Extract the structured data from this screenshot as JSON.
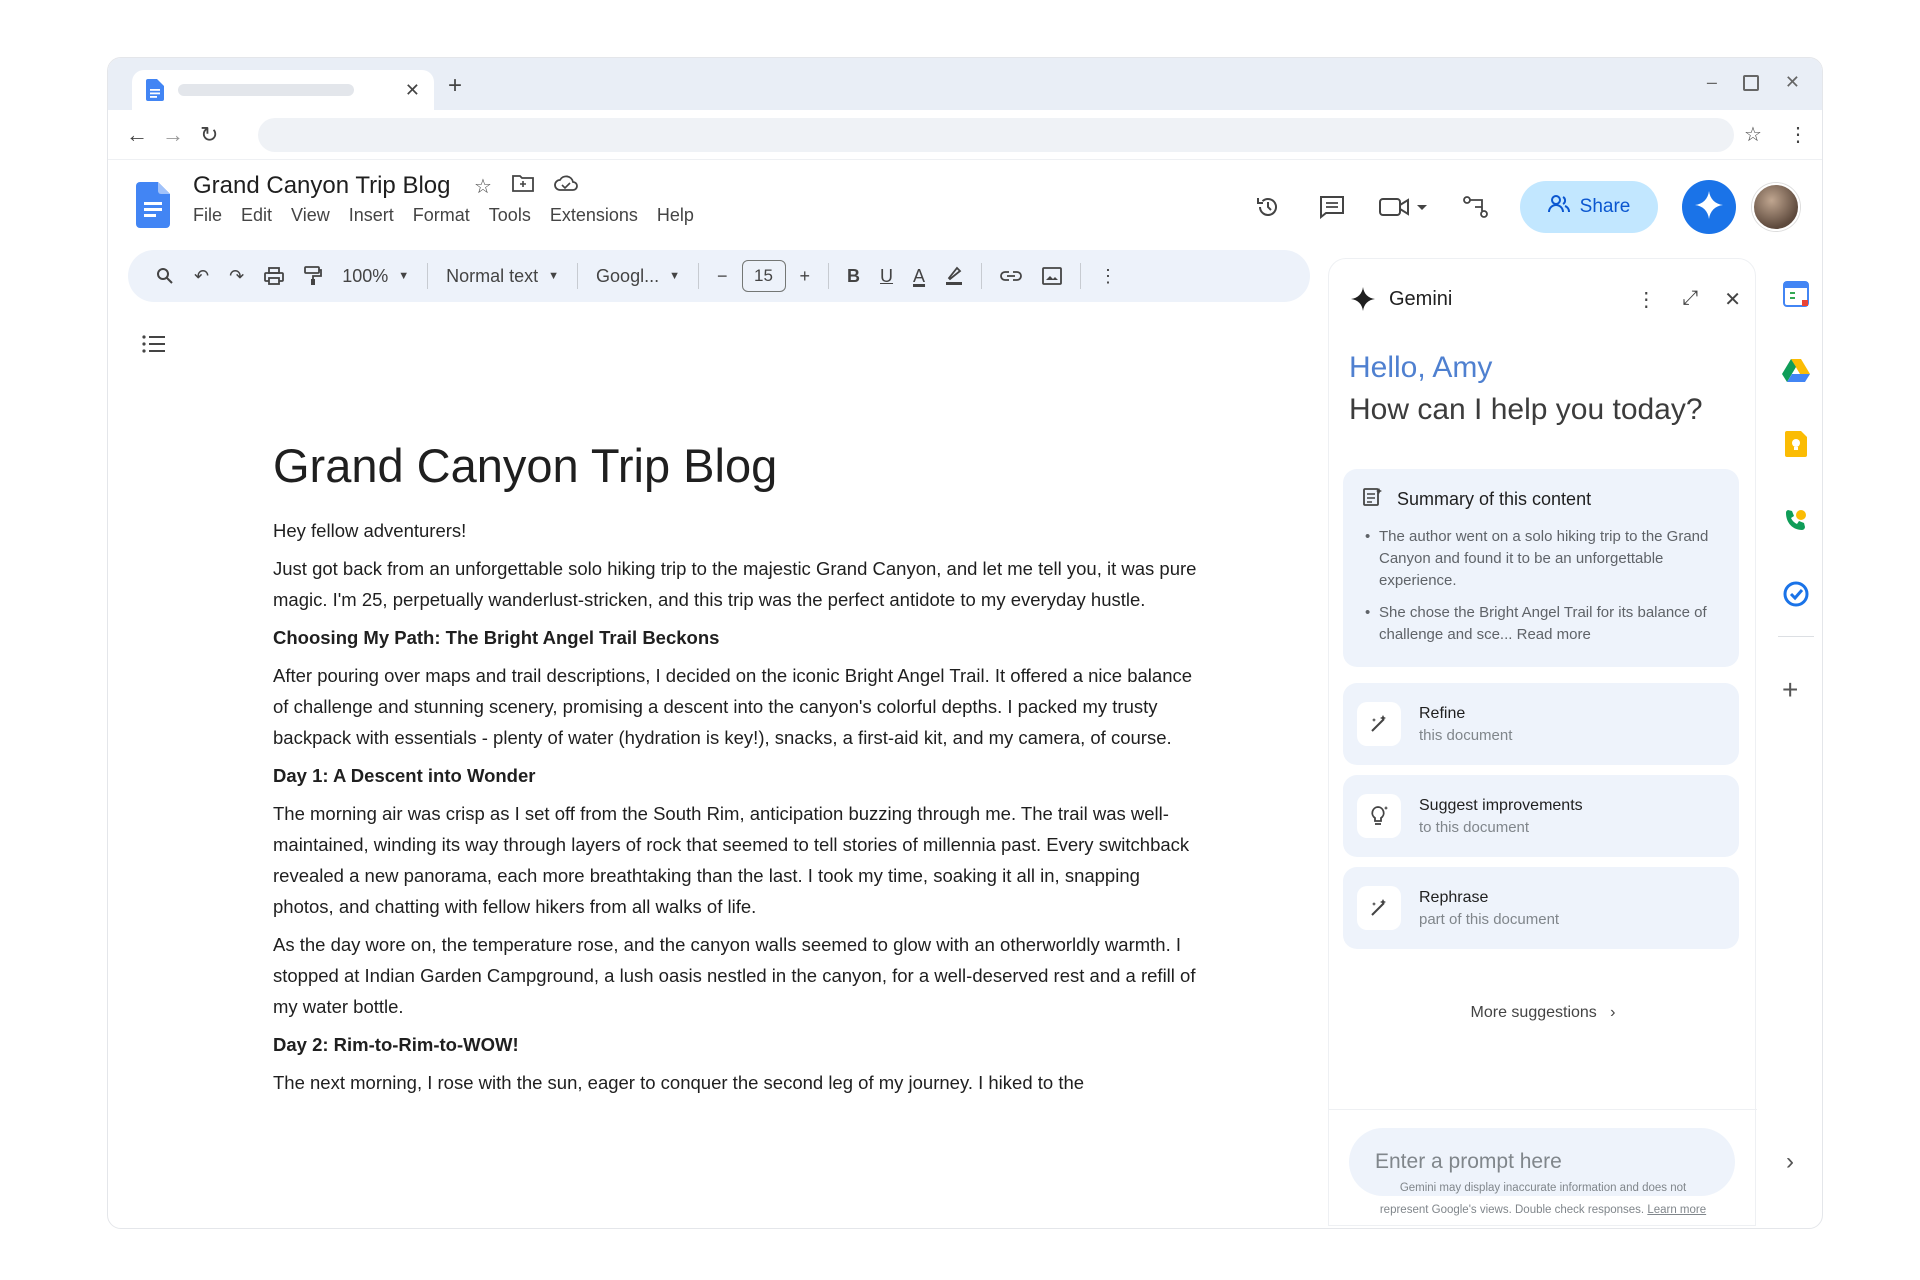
{
  "browser": {
    "tab_close": "✕",
    "new_tab": "+",
    "win_min": "–",
    "win_close": "✕",
    "back": "←",
    "forward": "→",
    "reload": "↻",
    "bookmark": "☆",
    "menu": "⋮"
  },
  "docs": {
    "title": "Grand Canyon Trip Blog",
    "menu": [
      "File",
      "Edit",
      "View",
      "Insert",
      "Format",
      "Tools",
      "Extensions",
      "Help"
    ],
    "share_label": "Share",
    "accent_color": "#1a73e8"
  },
  "toolbar": {
    "zoom": "100%",
    "style": "Normal text",
    "font": "Googl...",
    "font_size": "15",
    "minus": "−",
    "plus": "+",
    "bold": "B",
    "underline": "U",
    "text_color": "A",
    "more": "⋮"
  },
  "document": {
    "heading": "Grand Canyon Trip Blog",
    "p1": "Hey fellow adventurers!",
    "p2": "Just got back from an unforgettable solo hiking trip to the majestic Grand Canyon, and let me tell you, it was pure magic. I'm 25, perpetually wanderlust-stricken, and this trip was the perfect antidote to my everyday hustle.",
    "h2_1": "Choosing My Path: The Bright Angel Trail Beckons",
    "p3": "After pouring over maps and trail descriptions, I decided on the iconic Bright Angel Trail. It offered a nice balance of challenge and stunning scenery, promising a descent into the canyon's colorful depths. I packed my trusty backpack with essentials - plenty of water (hydration is key!), snacks, a first-aid kit, and my camera, of course.",
    "h2_2": "Day 1: A Descent into Wonder",
    "p4": "The morning air was crisp as I set off from the South Rim, anticipation buzzing through me. The trail was well-maintained, winding its way through layers of rock that seemed to tell stories of millennia past. Every switchback revealed a new panorama, each more breathtaking than the last. I took my time, soaking it all in, snapping photos, and chatting with fellow hikers from all walks of life.",
    "p5": "As the day wore on, the temperature rose, and the canyon walls seemed to glow with an otherworldly warmth. I stopped at Indian Garden Campground, a lush oasis nestled in the canyon, for a well-deserved rest and a refill of my water bottle.",
    "h2_3": "Day 2: Rim-to-Rim-to-WOW!",
    "p6": "The next morning, I rose with the sun, eager to conquer the second leg of my journey. I hiked to the"
  },
  "gemini": {
    "title": "Gemini",
    "more": "⋮",
    "expand": "⤢",
    "close": "✕",
    "hello": "Hello, Amy",
    "help": "How can I help you today?",
    "summary_title": "Summary of this content",
    "summary_1": "The author went on a solo hiking trip to the Grand Canyon and found it to be an unforgettable experience.",
    "summary_2": "She chose the Bright Angel Trail for its balance of challenge and sce...",
    "read_more": "Read more",
    "suggestions": [
      {
        "title": "Refine",
        "subtitle": "this document"
      },
      {
        "title": "Suggest improvements",
        "subtitle": "to this document"
      },
      {
        "title": "Rephrase",
        "subtitle": "part of this document"
      }
    ],
    "more_suggestions": "More suggestions",
    "prompt_placeholder": "Enter a prompt here",
    "disclaimer_1": "Gemini may display inaccurate information and does not",
    "disclaimer_2": "represent Google's views. Double check responses.",
    "learn_more": "Learn more"
  },
  "side_panel": {
    "plus": "+",
    "expand": "›"
  }
}
